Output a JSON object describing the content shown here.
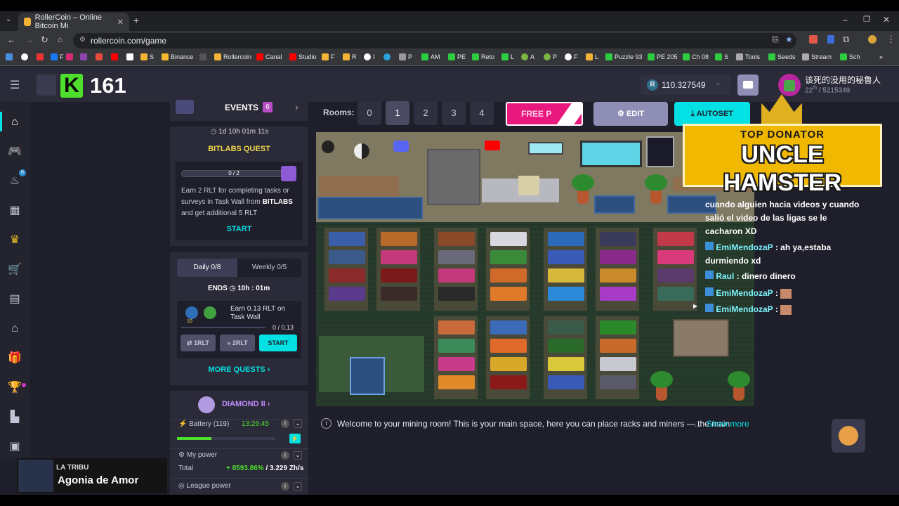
{
  "browser": {
    "tab_title": "RollerCoin – Online Bitcoin Mi",
    "url": "rollercoin.com/game",
    "bookmarks": [
      "F",
      "S",
      "Binance",
      "Rollercoin",
      "Canal",
      "Studio",
      "F",
      "R",
      "I",
      "P",
      "AM",
      "PE",
      "Reto",
      "L",
      "A",
      "P",
      "F",
      "L",
      "Puzzle 93",
      "PE 205",
      "Ch 08",
      "S",
      "Tools",
      "Seeds",
      "Stream",
      "Sch"
    ]
  },
  "header": {
    "level_letter": "K",
    "level_number": "161",
    "balance": "110.327549",
    "balance_currency": "R",
    "username": "该死的没用的秘鲁人",
    "rank_place": "22",
    "rank_suffix": "th",
    "rank_total": "/ 5215349"
  },
  "events": {
    "label": "EVENTS",
    "count": "6"
  },
  "quest": {
    "timer": "1d 10h 01m 11s",
    "title": "BITLABS QUEST",
    "progress": "0 / 2",
    "progress_fraction": 0,
    "desc_1": "Earn 2 RLT for completing tasks or surveys in Task Wall from ",
    "desc_brand": "BITLABS",
    "desc_2": " and get additional 5 RLT",
    "start": "START"
  },
  "daily": {
    "tab_daily": "Daily  0/8",
    "tab_weekly": "Weekly  0/5",
    "ends_label": "ENDS",
    "ends_time": "10h : 01m",
    "task_text": "Earn 0.13 RLT on Task Wall",
    "task_badge_xp": "10",
    "task_progress": "0 / 0.13",
    "btn_1": "1RLT",
    "btn_2": "2RLT",
    "start": "START",
    "more": "MORE QUESTS"
  },
  "league": {
    "name": "DIAMOND II",
    "battery_label": "Battery (119)",
    "battery_time": "13:29:45",
    "battery_fraction": 0.35,
    "my_power": "My power",
    "total_label": "Total",
    "total_pct": "+ 8593.86%",
    "total_sep": "/",
    "total_power": "3.229 Zh/s",
    "league_power": "League power"
  },
  "stream_overlay": {
    "brand": "LA TRIBU",
    "song": "Agonia de Amor"
  },
  "rooms": {
    "label": "Rooms:",
    "numbers": [
      "0",
      "1",
      "2",
      "3",
      "4"
    ],
    "active": "1",
    "free_label": "FREE P",
    "edit": "EDIT",
    "autoset": "AUTOSET"
  },
  "donator": {
    "top": "TOP DONATOR",
    "name": "UNCLE HAMSTER"
  },
  "chat": [
    {
      "name": "",
      "text": "cuando alguien hacia videos y cuando salió el video de las ligas se le cacharon XD"
    },
    {
      "name": "EmiMendozaP",
      "text": ": ah ya,estaba durmiendo xd"
    },
    {
      "name": "Raul",
      "text": ": dinero dinero"
    },
    {
      "name": "EmiMendozaP",
      "text": ":"
    },
    {
      "name": "EmiMendozaP",
      "text": ":"
    }
  ],
  "info": {
    "text": "Welcome to your mining room! This is your main space, here you can place racks and miners — the main",
    "ellipsis": "...",
    "show_more": "Show more"
  },
  "colors": {
    "accent": "#03e1e4",
    "level_green": "#4ddf2c",
    "panel": "#2a2a39",
    "bg": "#1f1f2b"
  }
}
